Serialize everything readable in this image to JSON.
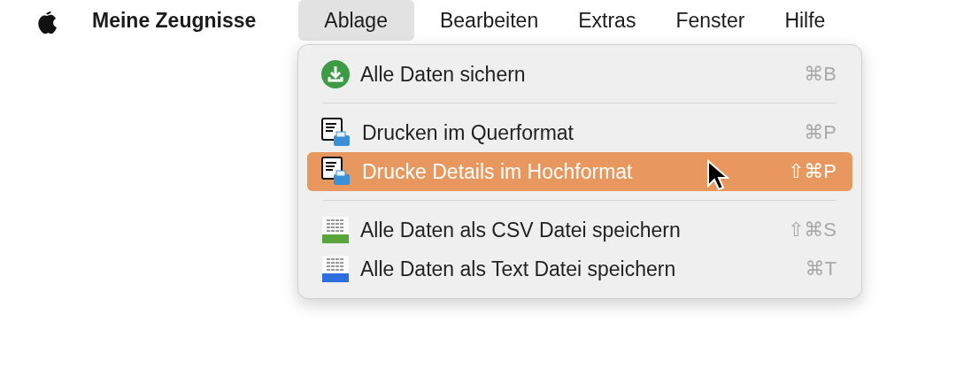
{
  "menu_bar": {
    "app_name": "Meine Zeugnisse",
    "menus": [
      {
        "label": "Ablage",
        "selected": true
      },
      {
        "label": "Bearbeiten",
        "selected": false
      },
      {
        "label": "Extras",
        "selected": false
      },
      {
        "label": "Fenster",
        "selected": false
      },
      {
        "label": "Hilfe",
        "selected": false
      }
    ]
  },
  "dropdown": {
    "items": [
      {
        "kind": "download",
        "label": "Alle Daten sichern",
        "shortcut": "⌘B",
        "selected": false
      },
      {
        "kind": "separator"
      },
      {
        "kind": "print",
        "label": "Drucken im Querformat",
        "shortcut": "⌘P",
        "selected": false
      },
      {
        "kind": "print",
        "label": "Drucke Details im Hochformat",
        "shortcut": "⇧⌘P",
        "selected": true
      },
      {
        "kind": "separator"
      },
      {
        "kind": "csv",
        "label": "Alle Daten als CSV Datei speichern",
        "shortcut": "⇧⌘S",
        "selected": false
      },
      {
        "kind": "txt",
        "label": "Alle Daten als Text Datei speichern",
        "shortcut": "⌘T",
        "selected": false
      }
    ]
  }
}
